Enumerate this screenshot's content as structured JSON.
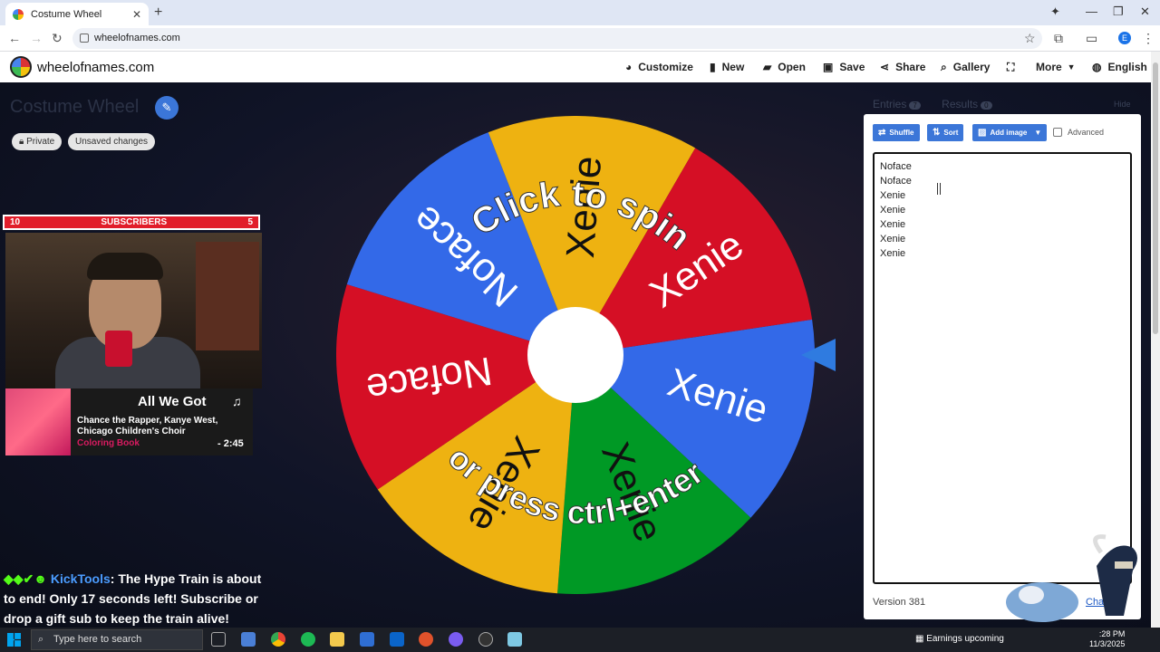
{
  "browser": {
    "tab_title": "Costume Wheel",
    "new_tab": "+",
    "tab_close": "✕",
    "url": "wheelofnames.com",
    "profile_initial": "E",
    "window_controls": [
      "—",
      "❐",
      "✕"
    ]
  },
  "site": {
    "brand": "wheelofnames.com",
    "menu": [
      {
        "label": "Customize",
        "icon": "palette-icon"
      },
      {
        "label": "New",
        "icon": "file-icon"
      },
      {
        "label": "Open",
        "icon": "folder-icon"
      },
      {
        "label": "Save",
        "icon": "save-icon"
      },
      {
        "label": "Share",
        "icon": "share-icon"
      },
      {
        "label": "Gallery",
        "icon": "search-icon"
      },
      {
        "label": "",
        "icon": "fullscreen-icon"
      },
      {
        "label": "More",
        "icon": "chevron-down-icon"
      },
      {
        "label": "English",
        "icon": "globe-icon"
      }
    ]
  },
  "wheel": {
    "title": "Costume Wheel",
    "chips": [
      "Private",
      "Unsaved changes"
    ],
    "spin_text_top": "Click to spin",
    "spin_text_bottom": "or press ctrl+enter",
    "segments": [
      {
        "label": "Xenie",
        "color": "#3369e8"
      },
      {
        "label": "Xenie",
        "color": "#009925"
      },
      {
        "label": "Xenie",
        "color": "#eeb211"
      },
      {
        "label": "Noface",
        "color": "#d50f25"
      },
      {
        "label": "Noface",
        "color": "#3369e8"
      },
      {
        "label": "Xenie",
        "color": "#eeb211"
      },
      {
        "label": "Xenie",
        "color": "#d50f25"
      }
    ]
  },
  "panel": {
    "tabs": [
      {
        "label": "Entries",
        "count": "7"
      },
      {
        "label": "Results",
        "count": "0"
      }
    ],
    "hide": "Hide",
    "buttons": {
      "shuffle": "Shuffle",
      "sort": "Sort",
      "add_image": "Add image"
    },
    "advanced": "Advanced",
    "entries": [
      "Noface",
      "Noface",
      "Xenie",
      "Xenie",
      "Xenie",
      "Xenie",
      "Xenie"
    ],
    "version": "Version 381",
    "changelog": "Cha"
  },
  "overlay": {
    "sub_left": "10",
    "sub_label": "SUBSCRIBERS",
    "sub_right": "5",
    "song": "All We Got",
    "artist": "Chance the Rapper, Kanye West, Chicago Children's Choir",
    "album": "Coloring Book",
    "time": "- 2:45",
    "chat_user": "KickTools",
    "chat_msg": ": The Hype Train is about to end! Only 17 seconds left! Subscribe or drop a gift sub to keep the train alive!"
  },
  "taskbar": {
    "search_placeholder": "Type here to search",
    "news": "Earnings upcoming",
    "clock_time": ":28 PM",
    "clock_date": "11/3/2025"
  }
}
